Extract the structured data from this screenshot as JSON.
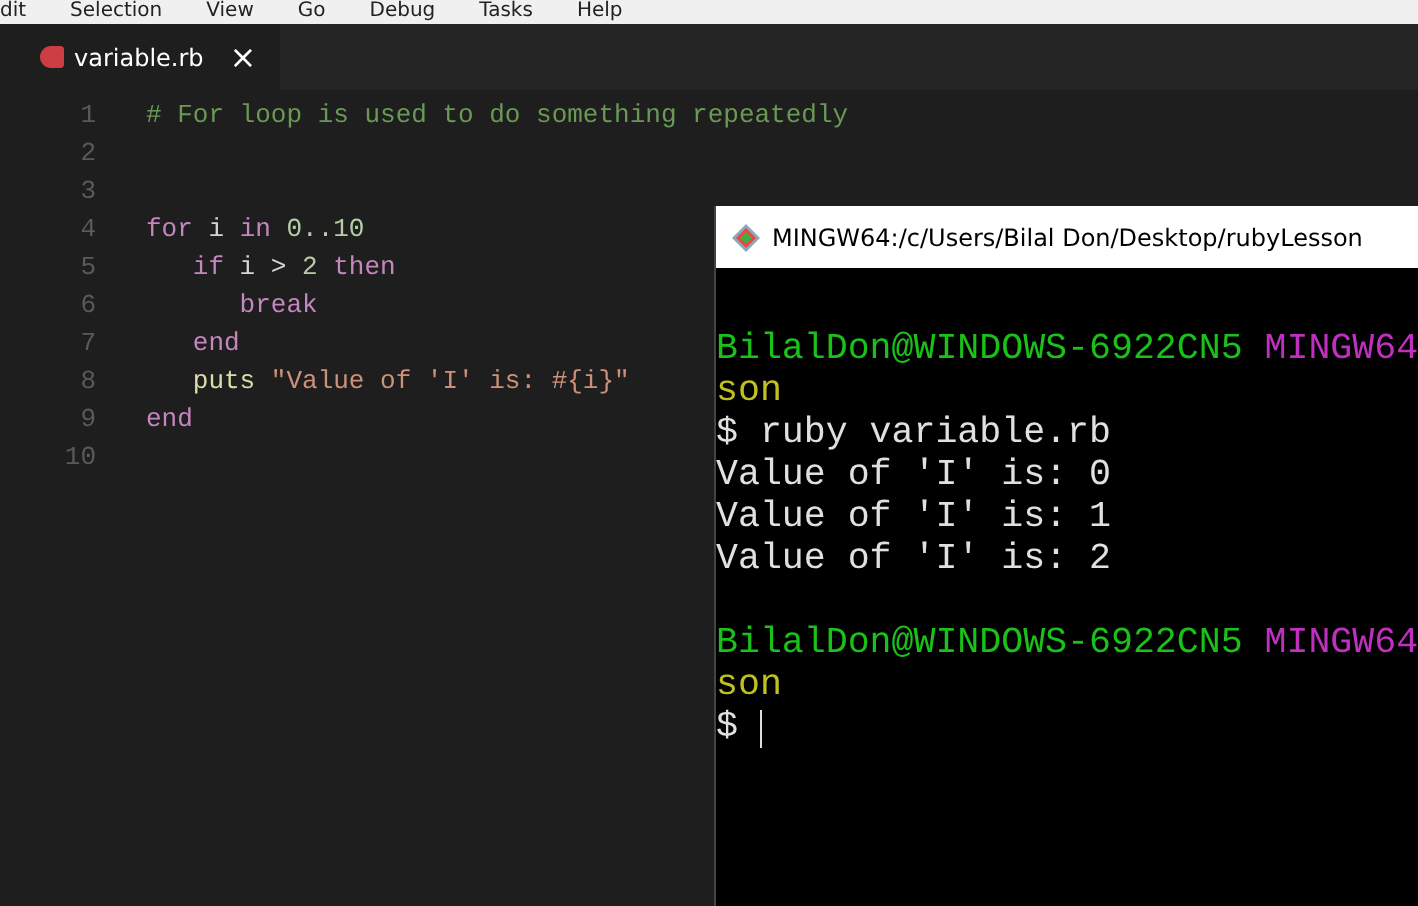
{
  "menu_bar": [
    "dit",
    "Selection",
    "View",
    "Go",
    "Debug",
    "Tasks",
    "Help"
  ],
  "tabs": [
    {
      "label": "variable.rb",
      "selected": true,
      "close": "×"
    }
  ],
  "editor": {
    "lines": [
      {
        "number": "1",
        "tokens": [
          {
            "kind": "comment",
            "text": "# For loop is used to do something repeatedly"
          }
        ]
      },
      {
        "number": "2"
      },
      {
        "number": "3"
      },
      {
        "number": "4",
        "tokens": [
          {
            "kind": "keyword",
            "text": "for"
          },
          {
            "kind": "plain",
            "text": " i "
          },
          {
            "kind": "keyword",
            "text": "in"
          },
          {
            "kind": "number",
            "text": " 0..10"
          }
        ],
        "children": [
          {
            "number": "5",
            "tokens": [
              {
                "kind": "keyword",
                "text": "if"
              },
              {
                "kind": "plain",
                "text": " i > "
              },
              {
                "kind": "number",
                "text": "2"
              },
              {
                "kind": "keyword",
                "text": " then"
              }
            ],
            "children": [
              {
                "number": "6",
                "tokens": [
                  {
                    "kind": "keyword",
                    "text": "break"
                  }
                ]
              }
            ]
          },
          {
            "number": "7",
            "tokens": [
              {
                "kind": "keyword",
                "text": "end"
              }
            ]
          },
          {
            "number": "8",
            "tokens": [
              {
                "kind": "function",
                "text": "puts"
              },
              {
                "kind": "string",
                "text": " \"Value of 'I' is: #{i}\""
              }
            ]
          }
        ]
      },
      {
        "number": "9",
        "tokens": [
          {
            "kind": "keyword",
            "text": "end"
          }
        ]
      },
      {
        "number": "10"
      }
    ]
  },
  "terminal": {
    "title": "MINGW64:/c/Users/Bilal Don/Desktop/rubyLesson",
    "lines": [
      {
        "blank_before": true,
        "segments": [
          {
            "kind": "user",
            "text": "BilalDon@WINDOWS-6922CN5"
          },
          {
            "kind": "system",
            "text": " MINGW64"
          }
        ]
      },
      {
        "segments": [
          {
            "kind": "path",
            "text": "son"
          }
        ]
      },
      {
        "segments": [
          {
            "kind": "plain",
            "text": "$ ruby variable.rb"
          }
        ]
      },
      {
        "segments": [
          {
            "kind": "plain",
            "text": "Value of 'I' is: 0"
          }
        ]
      },
      {
        "segments": [
          {
            "kind": "plain",
            "text": "Value of 'I' is: 1"
          }
        ]
      },
      {
        "segments": [
          {
            "kind": "plain",
            "text": "Value of 'I' is: 2"
          }
        ]
      },
      {
        "blank_before": true,
        "segments": [
          {
            "kind": "user",
            "text": "BilalDon@WINDOWS-6922CN5"
          },
          {
            "kind": "system",
            "text": " MINGW64"
          }
        ]
      },
      {
        "segments": [
          {
            "kind": "path",
            "text": "son"
          }
        ]
      },
      {
        "segments": [
          {
            "kind": "plain",
            "text": "$"
          }
        ],
        "cursor": true
      }
    ]
  }
}
